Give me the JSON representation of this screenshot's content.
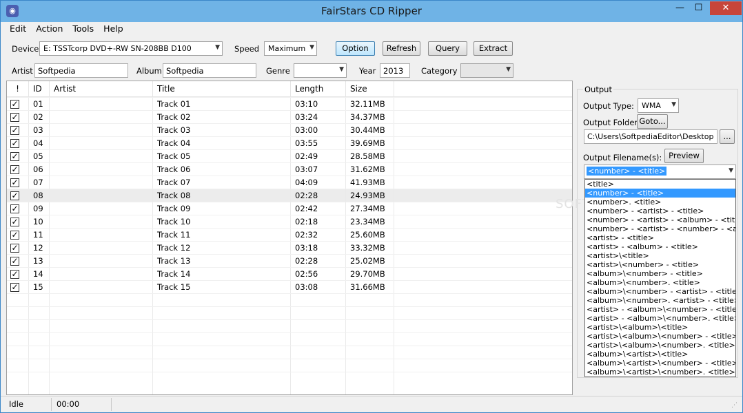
{
  "app": {
    "title": "FairStars CD Ripper",
    "icon": "cd-ripper-app-icon"
  },
  "window_controls": {
    "minimize": "—",
    "maximize": "☐",
    "close": "✕"
  },
  "menu": [
    "Edit",
    "Action",
    "Tools",
    "Help"
  ],
  "toolbar": {
    "device_label": "Device",
    "device_value": "E: TSSTcorp DVD+-RW SN-208BB D100",
    "speed_label": "Speed",
    "speed_value": "Maximum",
    "option_label": "Option",
    "refresh_label": "Refresh",
    "query_label": "Query",
    "extract_label": "Extract"
  },
  "album_info": {
    "artist_label": "Artist",
    "artist_value": "Softpedia",
    "album_label": "Album",
    "album_value": "Softpedia",
    "genre_label": "Genre",
    "genre_value": "",
    "year_label": "Year",
    "year_value": "2013",
    "category_label": "Category",
    "category_value": ""
  },
  "tracklist": {
    "columns": [
      "!",
      "ID",
      "Artist",
      "Title",
      "Length",
      "Size"
    ],
    "rows": [
      {
        "checked": true,
        "id": "01",
        "artist": "",
        "title": "Track 01",
        "length": "03:10",
        "size": "32.11MB"
      },
      {
        "checked": true,
        "id": "02",
        "artist": "",
        "title": "Track 02",
        "length": "03:24",
        "size": "34.37MB"
      },
      {
        "checked": true,
        "id": "03",
        "artist": "",
        "title": "Track 03",
        "length": "03:00",
        "size": "30.44MB"
      },
      {
        "checked": true,
        "id": "04",
        "artist": "",
        "title": "Track 04",
        "length": "03:55",
        "size": "39.69MB"
      },
      {
        "checked": true,
        "id": "05",
        "artist": "",
        "title": "Track 05",
        "length": "02:49",
        "size": "28.58MB"
      },
      {
        "checked": true,
        "id": "06",
        "artist": "",
        "title": "Track 06",
        "length": "03:07",
        "size": "31.62MB"
      },
      {
        "checked": true,
        "id": "07",
        "artist": "",
        "title": "Track 07",
        "length": "04:09",
        "size": "41.93MB"
      },
      {
        "checked": true,
        "id": "08",
        "artist": "",
        "title": "Track 08",
        "length": "02:28",
        "size": "24.93MB",
        "selected": true
      },
      {
        "checked": true,
        "id": "09",
        "artist": "",
        "title": "Track 09",
        "length": "02:42",
        "size": "27.34MB"
      },
      {
        "checked": true,
        "id": "10",
        "artist": "",
        "title": "Track 10",
        "length": "02:18",
        "size": "23.34MB"
      },
      {
        "checked": true,
        "id": "11",
        "artist": "",
        "title": "Track 11",
        "length": "02:32",
        "size": "25.60MB"
      },
      {
        "checked": true,
        "id": "12",
        "artist": "",
        "title": "Track 12",
        "length": "03:18",
        "size": "33.32MB"
      },
      {
        "checked": true,
        "id": "13",
        "artist": "",
        "title": "Track 13",
        "length": "02:28",
        "size": "25.02MB"
      },
      {
        "checked": true,
        "id": "14",
        "artist": "",
        "title": "Track 14",
        "length": "02:56",
        "size": "29.70MB"
      },
      {
        "checked": true,
        "id": "15",
        "artist": "",
        "title": "Track 15",
        "length": "03:08",
        "size": "31.66MB"
      }
    ]
  },
  "output": {
    "group_title": "Output",
    "type_label": "Output Type:",
    "type_value": "WMA",
    "folder_label": "Output Folder:",
    "goto_label": "Goto...",
    "folder_value": "C:\\Users\\SoftpediaEditor\\Desktop",
    "browse_label": "...",
    "filename_label": "Output Filename(s):",
    "preview_label": "Preview",
    "filename_value": "<number> - <title>",
    "filename_options": [
      "<title>",
      "<number> - <title>",
      "<number>. <title>",
      "<number> - <artist> - <title>",
      "<number> - <artist> - <album> - <title>",
      "<number> - <artist> - <number> - <album>",
      "<artist> - <title>",
      "<artist> - <album> - <title>",
      "<artist>\\<title>",
      "<artist>\\<number> - <title>",
      "<album>\\<number> - <title>",
      "<album>\\<number>. <title>",
      "<album>\\<number> - <artist> - <title>",
      "<album>\\<number>. <artist> - <title>",
      "<artist> - <album>\\<number> - <title>",
      "<artist> - <album>\\<number>. <title>",
      "<artist>\\<album>\\<title>",
      "<artist>\\<album>\\<number> - <title>",
      "<artist>\\<album>\\<number>. <title>",
      "<album>\\<artist>\\<title>",
      "<album>\\<artist>\\<number> - <title>",
      "<album>\\<artist>\\<number>. <title>"
    ],
    "selected_option_index": 1
  },
  "statusbar": {
    "status": "Idle",
    "time": "00:00"
  },
  "watermark": "SOFT"
}
